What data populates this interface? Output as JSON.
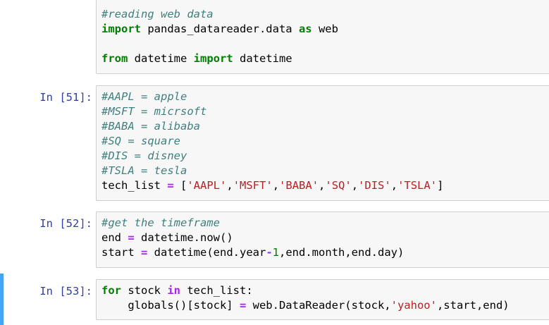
{
  "notebook": {
    "cells": [
      {
        "prompt": "",
        "selected": false,
        "lines": [
          [
            {
              "t": "#reading web data",
              "k": "cm"
            }
          ],
          [
            {
              "t": "import",
              "k": "kw"
            },
            {
              "t": " pandas_datareader.data ",
              "k": "nx"
            },
            {
              "t": "as",
              "k": "kw"
            },
            {
              "t": " web",
              "k": "nx"
            }
          ],
          [
            {
              "t": "",
              "k": "nx"
            }
          ],
          [
            {
              "t": "from",
              "k": "kw"
            },
            {
              "t": " datetime ",
              "k": "nx"
            },
            {
              "t": "import",
              "k": "kw"
            },
            {
              "t": " datetime",
              "k": "nx"
            }
          ]
        ]
      },
      {
        "prompt": "In [51]:",
        "selected": false,
        "lines": [
          [
            {
              "t": "#AAPL = apple",
              "k": "cm"
            }
          ],
          [
            {
              "t": "#MSFT = micrsoft",
              "k": "cm"
            }
          ],
          [
            {
              "t": "#BABA = alibaba",
              "k": "cm"
            }
          ],
          [
            {
              "t": "#SQ = square",
              "k": "cm"
            }
          ],
          [
            {
              "t": "#DIS = disney",
              "k": "cm"
            }
          ],
          [
            {
              "t": "#TSLA = tesla",
              "k": "cm"
            }
          ],
          [
            {
              "t": "tech_list ",
              "k": "nx"
            },
            {
              "t": "=",
              "k": "op"
            },
            {
              "t": " [",
              "k": "nx"
            },
            {
              "t": "'AAPL'",
              "k": "st"
            },
            {
              "t": ",",
              "k": "nx"
            },
            {
              "t": "'MSFT'",
              "k": "st"
            },
            {
              "t": ",",
              "k": "nx"
            },
            {
              "t": "'BABA'",
              "k": "st"
            },
            {
              "t": ",",
              "k": "nx"
            },
            {
              "t": "'SQ'",
              "k": "st"
            },
            {
              "t": ",",
              "k": "nx"
            },
            {
              "t": "'DIS'",
              "k": "st"
            },
            {
              "t": ",",
              "k": "nx"
            },
            {
              "t": "'TSLA'",
              "k": "st"
            },
            {
              "t": "]",
              "k": "nx"
            }
          ]
        ]
      },
      {
        "prompt": "In [52]:",
        "selected": false,
        "lines": [
          [
            {
              "t": "#get the timeframe",
              "k": "cm"
            }
          ],
          [
            {
              "t": "end ",
              "k": "nx"
            },
            {
              "t": "=",
              "k": "op"
            },
            {
              "t": " datetime.now()",
              "k": "nx"
            }
          ],
          [
            {
              "t": "start ",
              "k": "nx"
            },
            {
              "t": "=",
              "k": "op"
            },
            {
              "t": " datetime(end.year",
              "k": "nx"
            },
            {
              "t": "-",
              "k": "op"
            },
            {
              "t": "1",
              "k": "nm"
            },
            {
              "t": ",end.month,end.day)",
              "k": "nx"
            }
          ]
        ]
      },
      {
        "prompt": "In [53]:",
        "selected": true,
        "lines": [
          [
            {
              "t": "for",
              "k": "kw"
            },
            {
              "t": " stock ",
              "k": "nx"
            },
            {
              "t": "in",
              "k": "op"
            },
            {
              "t": " tech_list:",
              "k": "nx"
            }
          ],
          [
            {
              "t": "    globals()[stock] ",
              "k": "nx"
            },
            {
              "t": "=",
              "k": "op"
            },
            {
              "t": " web.DataReader(stock,",
              "k": "nx"
            },
            {
              "t": "'yahoo'",
              "k": "st"
            },
            {
              "t": ",start,end)",
              "k": "nx"
            }
          ]
        ]
      }
    ]
  }
}
